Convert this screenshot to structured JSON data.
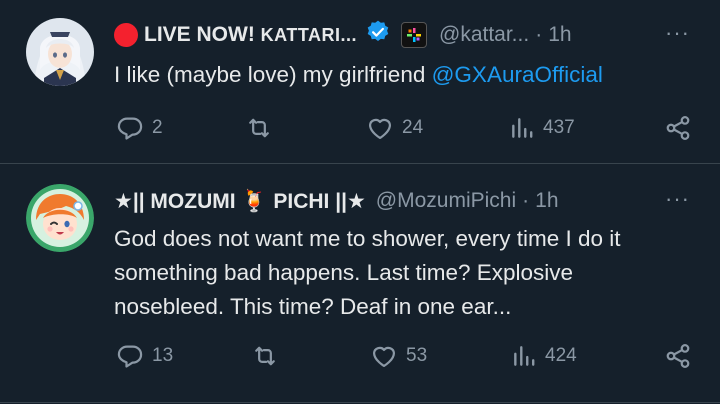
{
  "tweets": [
    {
      "display_name_prefix": "LIVE NOW! ",
      "display_name_main": "KATTARI...",
      "handle": "@kattar...",
      "dot": "·",
      "time": "1h",
      "more": "···",
      "text": "I like (maybe love) my girlfriend ",
      "mention": "@GXAuraOfficial",
      "text_lines": [],
      "replies": "2",
      "retweets": "",
      "likes": "24",
      "views": "437",
      "icons": [
        "live-red-circle-icon",
        "verified-badge-icon",
        "affiliate-badge-icon",
        "reply-icon",
        "retweet-icon",
        "like-icon",
        "views-icon",
        "share-icon"
      ]
    },
    {
      "display_name": "★|| MOZUMI 🍹 PICHI ||★",
      "handle": "@MozumiPichi",
      "dot": "·",
      "time": "1h",
      "more": "···",
      "text_lines": [
        "God does not want me to shower, every time I do it",
        "something bad happens. Last time? Explosive",
        "nosebleed. This time? Deaf in one ear..."
      ],
      "replies": "13",
      "retweets": "",
      "likes": "53",
      "views": "424"
    }
  ],
  "colors": {
    "background": "#15202b",
    "divider": "#38444d",
    "text": "#e7e9ea",
    "secondary": "#8b98a5",
    "link": "#1d9bf0",
    "live": "#f4212e",
    "verified": "#1d9bf0"
  }
}
